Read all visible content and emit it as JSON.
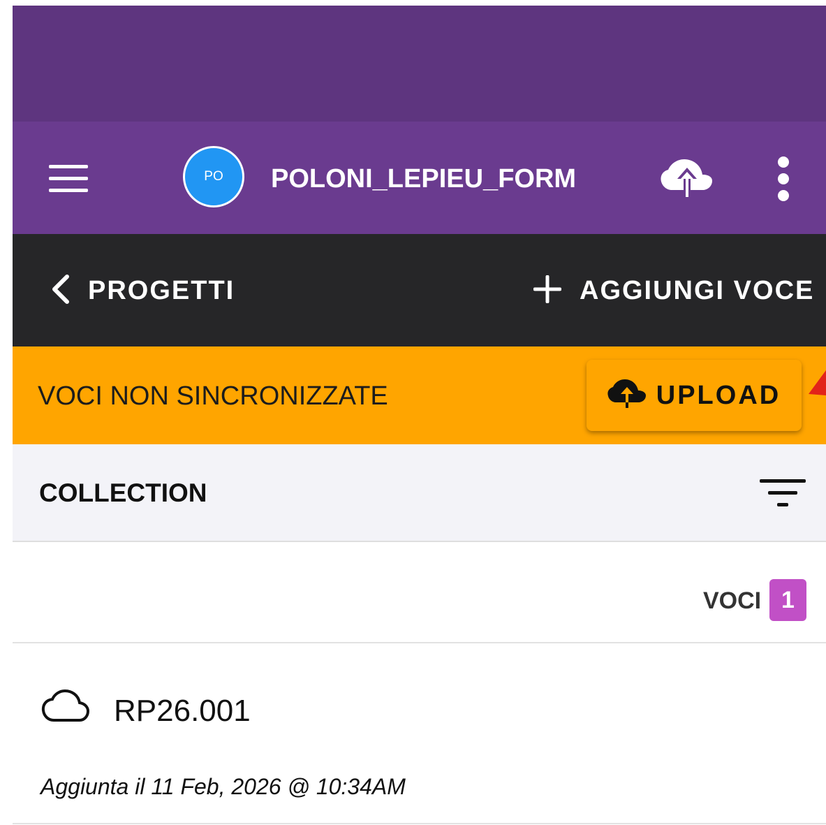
{
  "app_bar": {
    "avatar_initials": "PO",
    "title": "POLONI_LEPIEU_FORM",
    "icons": [
      "hamburger-menu-icon",
      "cloud-upload-icon",
      "kebab-menu-icon"
    ]
  },
  "nav_bar": {
    "back_label": "PROGETTI",
    "add_label": "AGGIUNGI VOCE"
  },
  "sync_banner": {
    "message": "VOCI NON SINCRONIZZATE",
    "upload_label": "UPLOAD"
  },
  "collection": {
    "title": "COLLECTION",
    "count_label": "VOCI",
    "count": "1"
  },
  "entries": [
    {
      "title": "RP26.001",
      "date": "Aggiunta il 11 Feb, 2026 @ 10:34AM",
      "icon": "cloud-outline-icon"
    }
  ],
  "colors": {
    "status_bar": "#5e357f",
    "app_bar": "#6a3b8f",
    "nav_bar": "#262628",
    "sync_banner": "#ffa500",
    "avatar": "#2196f3",
    "badge": "#c150c6"
  }
}
